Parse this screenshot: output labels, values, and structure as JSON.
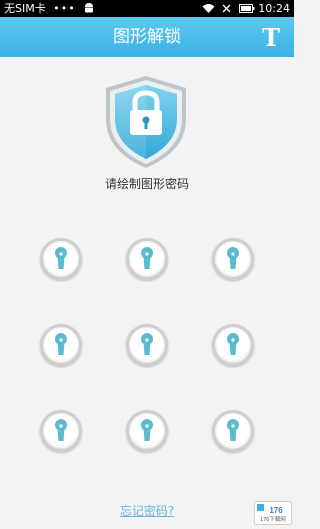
{
  "status_bar": {
    "carrier": "无SIM卡",
    "dots": "•••",
    "time": "10:24"
  },
  "app_bar": {
    "title": "图形解锁",
    "font_button_label": "T"
  },
  "shield_icon": "lock-shield-icon",
  "prompt": "请绘制图形密码",
  "pattern_grid": {
    "rows": 3,
    "cols": 3
  },
  "forgot_password": "忘记密码?",
  "watermark": "176下载网",
  "colors": {
    "accent": "#3cb1e4",
    "dot_center": "#5bbccf",
    "link": "#6ab6e0"
  }
}
